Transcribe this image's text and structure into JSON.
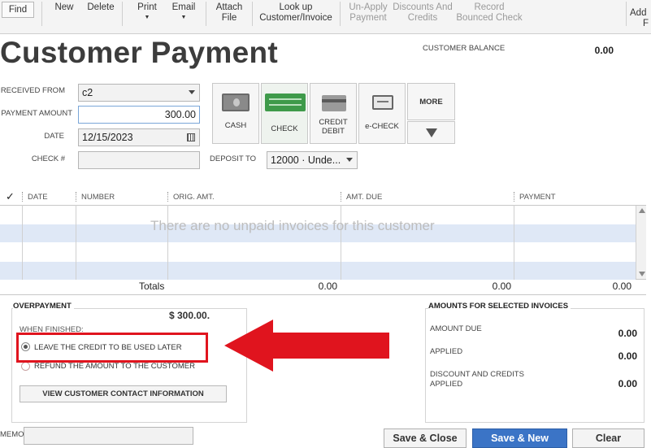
{
  "toolbar": {
    "find": "Find",
    "new": "New",
    "delete": "Delete",
    "print": "Print",
    "email": "Email",
    "attach_line1": "Attach",
    "attach_line2": "File",
    "lookup_line1": "Look up",
    "lookup_line2": "Customer/Invoice",
    "unapply_line1": "Un-Apply",
    "unapply_line2": "Payment",
    "discounts_line1": "Discounts And",
    "discounts_line2": "Credits",
    "record_line1": "Record",
    "record_line2": "Bounced Check",
    "add_line1": "Add",
    "add_line2": "F"
  },
  "header": {
    "title": "Customer Payment",
    "customer_balance_label": "CUSTOMER BALANCE",
    "customer_balance_value": "0.00"
  },
  "form": {
    "received_from_label": "RECEIVED FROM",
    "received_from_value": "c2",
    "payment_amount_label": "PAYMENT AMOUNT",
    "payment_amount_value": "300.00",
    "date_label": "DATE",
    "date_value": "12/15/2023",
    "check_no_label": "CHECK #",
    "check_no_value": "",
    "deposit_to_label": "DEPOSIT TO",
    "deposit_to_value": "12000 · Unde..."
  },
  "payment_methods": {
    "cash": "CASH",
    "check": "CHECK",
    "credit_line1": "CREDIT",
    "credit_line2": "DEBIT",
    "echeck": "e-CHECK",
    "more": "MORE"
  },
  "table": {
    "headers": {
      "check": "✓",
      "date": "DATE",
      "number": "NUMBER",
      "orig_amt": "ORIG. AMT.",
      "amt_due": "AMT. DUE",
      "payment": "PAYMENT"
    },
    "empty_message": "There are no unpaid invoices for this customer",
    "totals_label": "Totals",
    "total_orig": "0.00",
    "total_due": "0.00",
    "total_payment": "0.00"
  },
  "overpayment": {
    "title": "OVERPAYMENT",
    "amount": "$ 300.00.",
    "when_finished": "WHEN FINISHED:",
    "option_credit": "LEAVE THE CREDIT TO BE USED LATER",
    "option_refund": "REFUND THE AMOUNT TO THE CUSTOMER",
    "view_contact": "VIEW CUSTOMER CONTACT INFORMATION"
  },
  "selected_amounts": {
    "title": "AMOUNTS FOR SELECTED INVOICES",
    "amount_due_label": "AMOUNT DUE",
    "amount_due_value": "0.00",
    "applied_label": "APPLIED",
    "applied_value": "0.00",
    "discount_line1": "DISCOUNT AND CREDITS",
    "discount_line2": "APPLIED",
    "discount_value": "0.00"
  },
  "footer": {
    "memo_label": "MEMO",
    "save_close": "Save & Close",
    "save_new": "Save & New",
    "clear": "Clear"
  },
  "colors": {
    "highlight": "#e0141e",
    "primary_button": "#3b74c6",
    "row_alt": "#dfe8f6"
  }
}
